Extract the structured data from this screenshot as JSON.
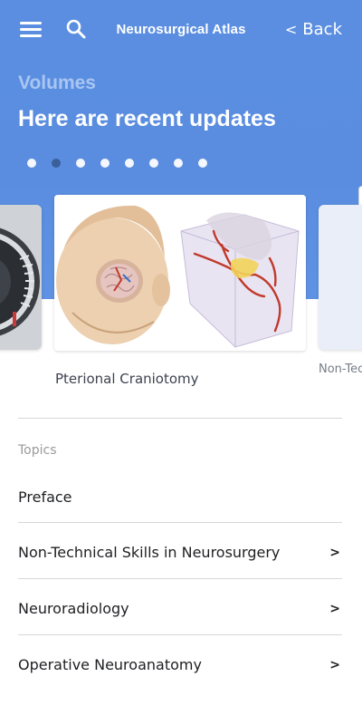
{
  "header": {
    "title": "Neurosurgical Atlas",
    "back_label": "Back",
    "back_chevron": "<",
    "menu_icon": "hamburger-menu-icon",
    "search_icon": "search-icon"
  },
  "hero": {
    "eyebrow": "Volumes",
    "headline": "Here are recent updates",
    "dots_total": 8,
    "active_dot": 1
  },
  "carousel": {
    "main_caption": "Pterional Craniotomy",
    "right_caption": "Non-Tec"
  },
  "topics": {
    "label": "Topics",
    "items": [
      {
        "label": "Preface",
        "arrow": ""
      },
      {
        "label": "Non-Technical Skills in Neurosurgery",
        "arrow": ">"
      },
      {
        "label": "Neuroradiology",
        "arrow": ">"
      },
      {
        "label": "Operative Neuroanatomy",
        "arrow": ">"
      }
    ]
  },
  "colors": {
    "hero_blue": "#5b8ee0",
    "active_dot": "#3a5f99",
    "eyebrow": "#a9c6f2"
  }
}
